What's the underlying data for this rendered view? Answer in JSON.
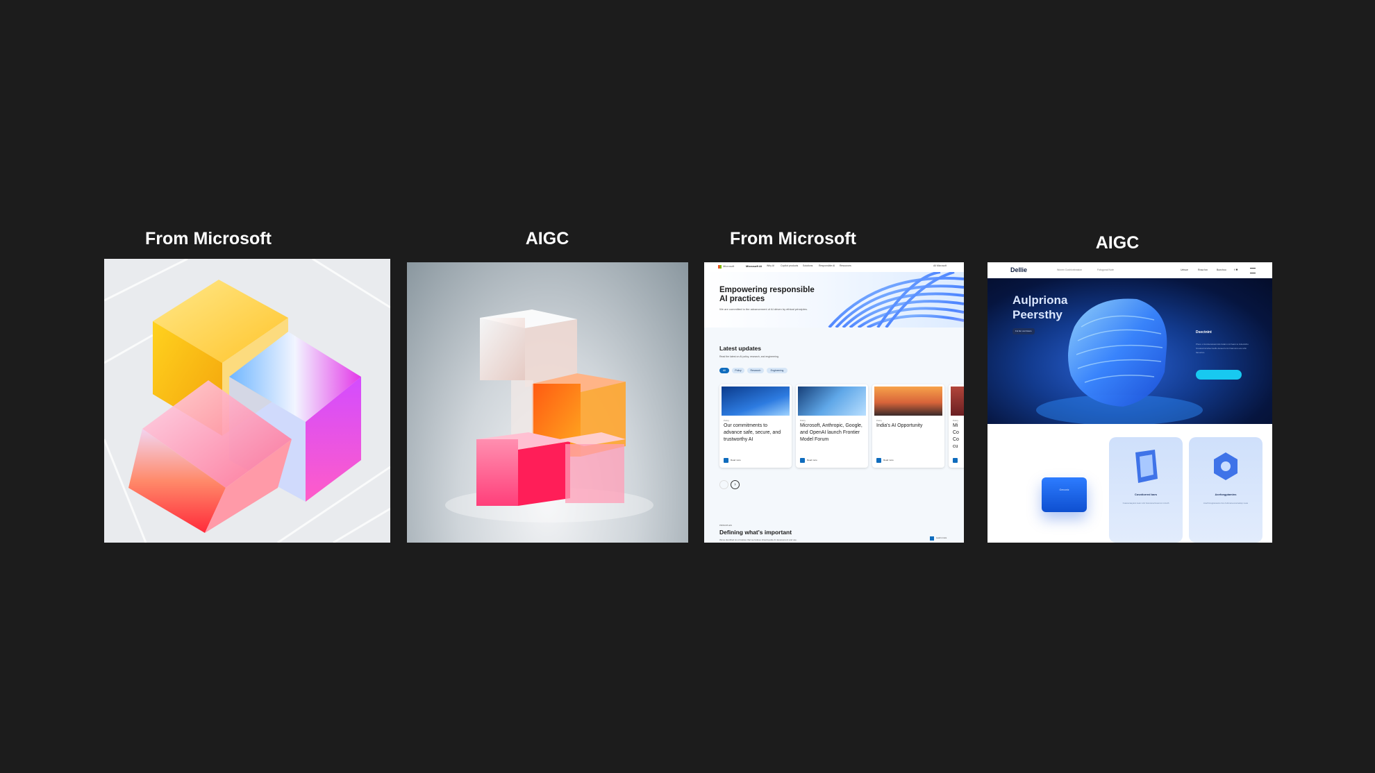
{
  "labels": [
    "From Microsoft",
    "AIGC",
    "From Microsoft",
    "AIGC"
  ],
  "colors": {
    "background": "#1c1c1c",
    "label": "#ffffff",
    "ms_blue": "#0f6cbd",
    "aigc_cyan": "#18c9f0"
  },
  "microsoft_page": {
    "brand": "Microsoft",
    "product": "Microsoft AI",
    "nav_items": [
      "Why AI",
      "Copilot products",
      "Solutions",
      "Responsible AI",
      "Resources"
    ],
    "nav_right": "All Microsoft",
    "hero_title": "Empowering responsible AI practices",
    "hero_sub": "We are committed to the advancement of AI driven by ethical principles.",
    "updates_title": "Latest updates",
    "updates_sub": "Read the latest on AI policy, research, and engineering.",
    "chips": [
      "All",
      "Policy",
      "Research",
      "Engineering"
    ],
    "cards": [
      {
        "tag": "Policy",
        "title": "Our commitments to advance safe, secure, and trustworthy AI",
        "cta": "Read more"
      },
      {
        "tag": "Policy",
        "title": "Microsoft, Anthropic, Google, and OpenAI launch Frontier Model Forum",
        "cta": "Read more"
      },
      {
        "tag": "Policy",
        "title": "India's AI Opportunity",
        "cta": "Read more"
      },
      {
        "tag": "Policy",
        "title": "Mi Co Co cu",
        "cta": ""
      }
    ],
    "section_label": "PRINCIPLES",
    "section_title": "Defining what's important",
    "section_sub": "We've identified six principles that we believe should guide AI development and use.",
    "section_cta": "Learn more"
  },
  "aigc_page": {
    "logo": "Dellie",
    "nav_center": [
      "Woven Cushionbrasion",
      "Fotogonal Note"
    ],
    "nav_right": [
      "Ueisue",
      "Rosa fon",
      "Bunchoo"
    ],
    "nav_icons": "f ✱",
    "hero_title_1": "Au|priona",
    "hero_title_2": "Peersthy",
    "hero_button": "Fol ifer ond listers",
    "side_title": "Dsectnint",
    "side_text": "Phere s Grotstereloamrstis fetaim mct fears to indemtcho hnsoisutmicwhecnsoflo deneorro ttc fcansnmo aro whn fanusrtco.",
    "card_blue_title": "Greconiz",
    "cards": [
      {
        "title": "Covotiorred bars",
        "text": "Cuacecaayans leam sttc fetocanertnaomot mrcoth"
      },
      {
        "title": "Axefoegpiamins",
        "text": "Anethmsgrassams ttce fettmaneonamatwp neas"
      }
    ]
  }
}
